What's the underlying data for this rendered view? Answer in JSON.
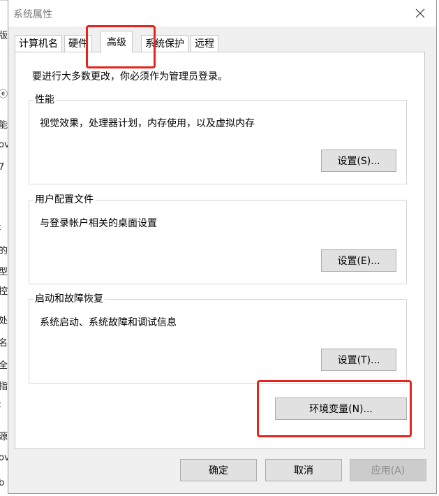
{
  "background_window": {
    "glyphs": [
      "版",
      "ⓔ",
      "能",
      "ov",
      "7",
      "ː",
      "的",
      "型",
      "控",
      "处",
      "名",
      "全",
      "指",
      "ː",
      "源",
      "ov",
      "b"
    ]
  },
  "dialog": {
    "title": "系统属性",
    "close_icon": "close-icon",
    "tabs": [
      {
        "label": "计算机名"
      },
      {
        "label": "硬件"
      },
      {
        "label": "高级"
      },
      {
        "label": "系统保护"
      },
      {
        "label": "远程"
      }
    ],
    "active_tab": "高级",
    "notice": "要进行大多数更改，你必须作为管理员登录。",
    "groups": {
      "performance": {
        "title": "性能",
        "description": "视觉效果，处理器计划，内存使用，以及虚拟内存",
        "button": "设置(S)..."
      },
      "user_profiles": {
        "title": "用户配置文件",
        "description": "与登录帐户相关的桌面设置",
        "button": "设置(E)..."
      },
      "startup_recovery": {
        "title": "启动和故障恢复",
        "description": "系统启动、系统故障和调试信息",
        "button": "设置(T)..."
      }
    },
    "env_button": "环境变量(N)...",
    "footer": {
      "ok": "确定",
      "cancel": "取消",
      "apply": "应用(A)"
    }
  },
  "annotation_color": "#e8231b"
}
